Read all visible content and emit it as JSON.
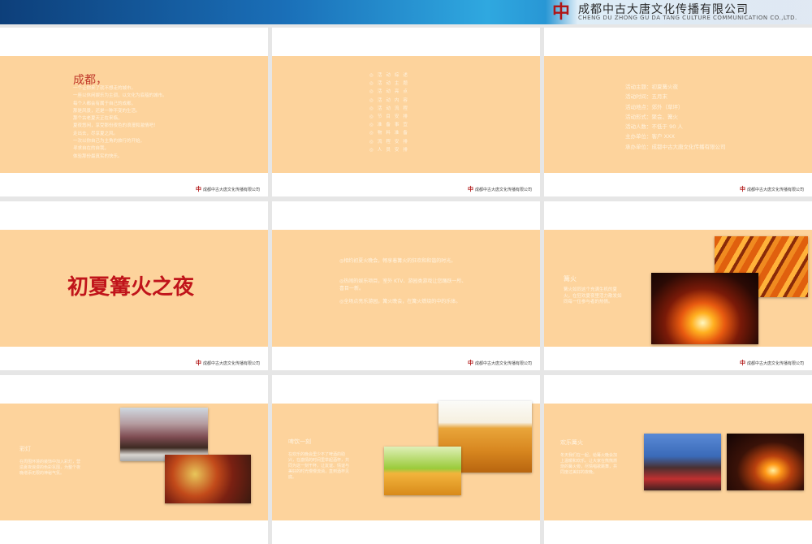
{
  "header": {
    "logo_mark": "中",
    "company_cn": "成都中古大唐文化传播有限公司",
    "company_en": "CHENG DU ZHONG GU DA TANG CULTURE COMMUNICATION CO.,LTD."
  },
  "footer_company": "成都中古大唐文化传播有限公司",
  "slide1": {
    "title": "成都，",
    "lines": [
      "一个让你来了就不想走的城市。",
      "一座以休闲娱乐为主调，以文化为底蕴的城市。",
      "每个人都会有属于自己的成都，",
      "那是风景，还是一种不变的生活。",
      "那个古老夏天正在来临，",
      "夏夜悠闲，享受那份夜色的浪漫和激情吧！",
      "走出去，尽享夏之风。",
      "一次以你自己为主角的旅行的开始，",
      "寻求自在的自我，",
      "体验那份最真实的快乐。"
    ]
  },
  "slide2": {
    "items": [
      "活动综述",
      "活动主题",
      "活动亮点",
      "活动内容",
      "活动流程",
      "节目安排",
      "准备事宜",
      "物料准备",
      "流程安排",
      "人员安排"
    ]
  },
  "slide3": {
    "lines": [
      "活动主题：初夏篝火夜",
      "活动时间：五月末",
      "活动地点：郊外（草坪）",
      "活动形式：聚会、篝火",
      "活动人数：不低于 90 人",
      "主办单位：客户 XXX",
      "承办单位：成都中古大唐文化传播有限公司"
    ]
  },
  "slide4": {
    "title": "初夏篝火之夜"
  },
  "slide5": {
    "paras": [
      "◎相约初夏火晚会，畅享着篝火的狂欢和和谐的时光。",
      "◎热闹的娱乐项目，室外 KTV、游园类游戏让您踊跃一所、喜目一新。",
      "◎全场点亮乐游园，篝火晚会，在篝火燃烧的中的乐体。"
    ]
  },
  "slide6": {
    "heading": "篝火",
    "text": "篝火如同这个充满生机的夏火，在狂欢夏夜里活力散发如同每一位参与者的热情。"
  },
  "slide7": {
    "heading": "彩灯",
    "text": "在周围环境的装饰中加入彩灯，营造夏夜浪漫的色彩氛围，为整个夜晚增添无限的神秘气氛。"
  },
  "slide8": {
    "heading": "啤饮一刻",
    "text": "在欢乐的晚会里少不了啤酒的助兴，在激情的时间里举起酒杯，共同为这一刻干杯，让友谊、情谊与美好的时光慢慢流淌，直到酒杯见底。"
  },
  "slide9": {
    "heading": "欢乐篝火",
    "text": "冬天我们在一起，给篝火晚会加上温暖和欢乐。让大家在熊熊燃烧的篝火旁，尽情唱歌跳舞，共同度过美好的夜晚。"
  }
}
